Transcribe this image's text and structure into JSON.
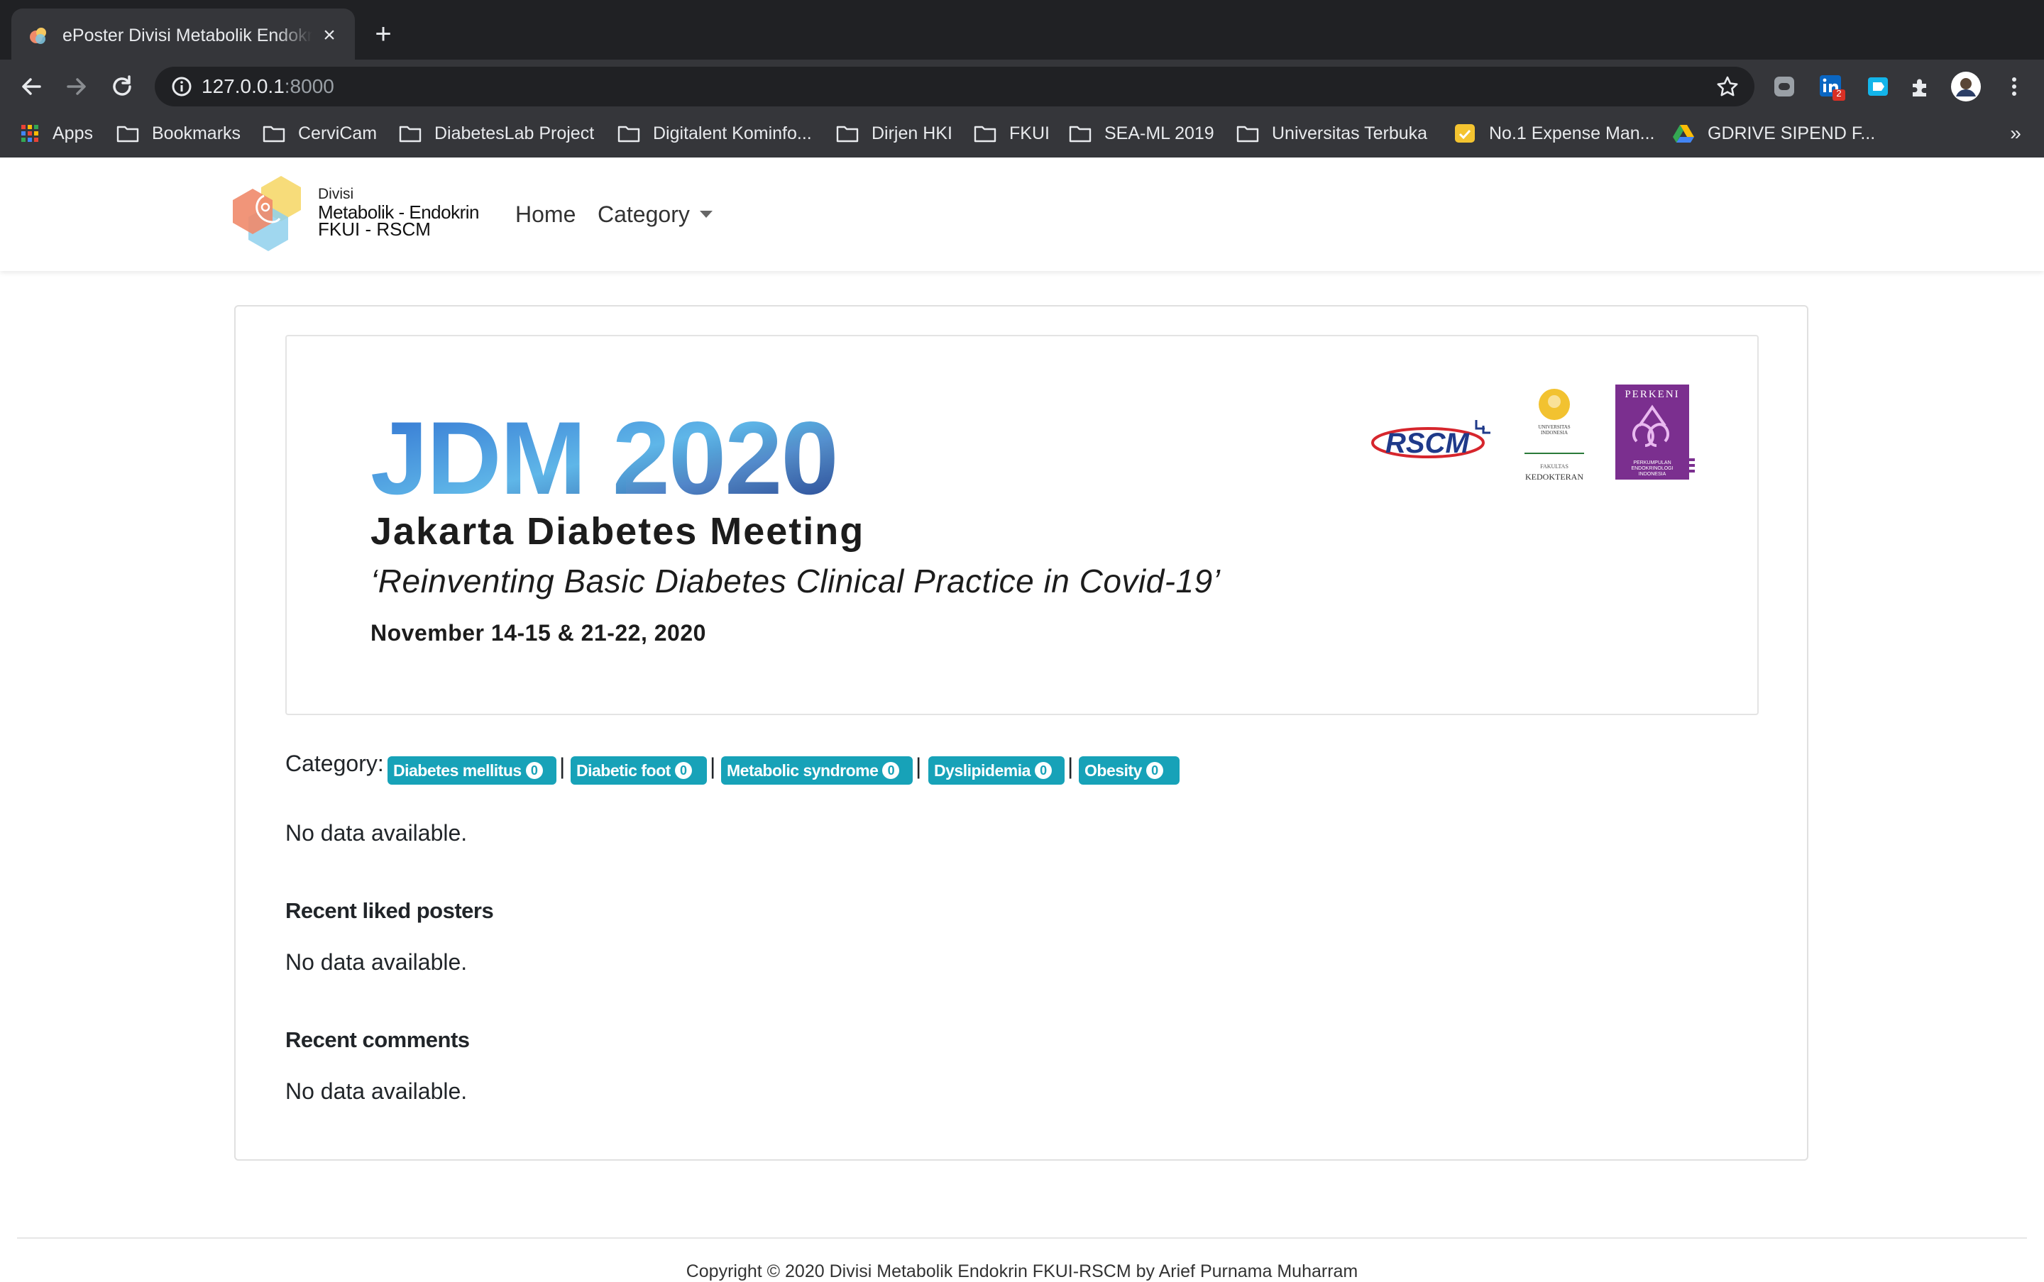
{
  "browser": {
    "tab_title": "ePoster Divisi Metabolik Endokrin FKUI-RSCM",
    "close_glyph": "×",
    "new_tab_glyph": "+",
    "url_host": "127.0.0.1",
    "url_port": ":8000",
    "bookmarks": [
      "Apps",
      "Bookmarks",
      "CerviCam",
      "DiabetesLab Project",
      "Digitalent Kominfo...",
      "Dirjen HKI",
      "FKUI",
      "SEA-ML 2019",
      "Universitas Terbuka",
      "No.1 Expense Man...",
      "GDRIVE SIPEND F..."
    ],
    "bookmarks_more": "»",
    "extension_badge": "2",
    "accent_colors": {
      "chrome_dark": "#202124",
      "chrome_mid": "#35363a",
      "badge_red": "#d93025"
    }
  },
  "navbar": {
    "brand_small": "Divisi",
    "brand_line2": "Metabolik - Endokrin",
    "brand_line3": "FKUI - RSCM",
    "home": "Home",
    "category": "Category"
  },
  "banner": {
    "title": "JDM 2020",
    "subtitle": "Jakarta Diabetes Meeting",
    "theme": "‘Reinventing Basic Diabetes Clinical Practice in Covid-19’",
    "date": "November 14-15 & 21-22, 2020",
    "logo_rscm": "RSCM",
    "logo_ui_line1": "UNIVERSITAS",
    "logo_ui_line2": "INDONESIA",
    "logo_ui_fak": "FAKULTAS",
    "logo_ui_ked": "KEDOKTERAN",
    "logo_perkeni": "PERKENI",
    "logo_perkeni_sub1": "PERKUMPULAN",
    "logo_perkeni_sub2": "ENDOKRINOLOGI",
    "logo_perkeni_sub3": "INDONESIA"
  },
  "content": {
    "category_label": "Category:",
    "separator": "|",
    "categories": [
      {
        "label": "Diabetes mellitus",
        "count": "0"
      },
      {
        "label": "Diabetic foot",
        "count": "0"
      },
      {
        "label": "Metabolic syndrome",
        "count": "0"
      },
      {
        "label": "Dyslipidemia",
        "count": "0"
      },
      {
        "label": "Obesity",
        "count": "0"
      }
    ],
    "no_data": "No data available.",
    "recent_liked": "Recent liked posters",
    "recent_comments": "Recent comments",
    "badge_color": "#17a2b8"
  },
  "footer": {
    "text": "Copyright © 2020 Divisi Metabolik Endokrin FKUI-RSCM by Arief Purnama Muharram"
  }
}
